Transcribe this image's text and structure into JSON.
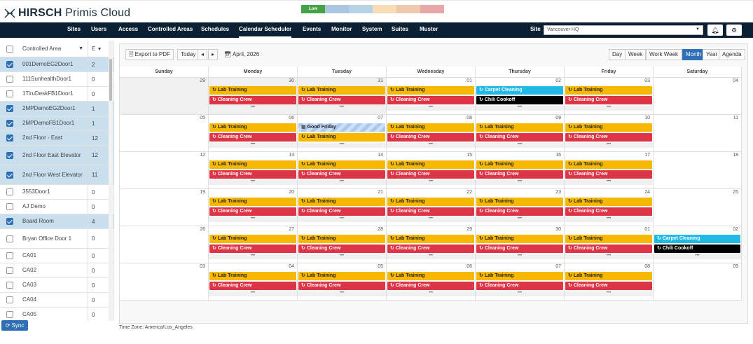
{
  "header": {
    "brand_bold": "HIRSCH",
    "brand_light": " Primis Cloud",
    "legend": [
      {
        "label": "Low",
        "color": "#43a443"
      },
      {
        "label": "",
        "color": "#a9c6e0"
      },
      {
        "label": "",
        "color": "#b8d2e6"
      },
      {
        "label": "",
        "color": "#f8dcb4"
      },
      {
        "label": "",
        "color": "#efc8b0"
      },
      {
        "label": "",
        "color": "#e8a7a7"
      }
    ]
  },
  "nav": {
    "items": [
      "Sites",
      "Users",
      "Access",
      "Controlled Areas",
      "Schedules",
      "Calendar Scheduler",
      "Events",
      "Monitor",
      "System",
      "Suites",
      "Muster"
    ],
    "active": "Calendar Scheduler",
    "site_label": "Site",
    "site_value": "Vancouver HQ"
  },
  "sidebar": {
    "col_area": "Controlled Area",
    "col_count": "E",
    "rows": [
      {
        "name": "001DemoEG2Door1",
        "count": "2",
        "checked": true
      },
      {
        "name": "111SunhealthDoor1",
        "count": "0",
        "checked": false
      },
      {
        "name": "1TiruDeskFB1Door1",
        "count": "0",
        "checked": false
      },
      {
        "name": "2MPDemoEG2Door1",
        "count": "1",
        "checked": true
      },
      {
        "name": "2MPDemoFB1Door1",
        "count": "1",
        "checked": true
      },
      {
        "name": "2nd Floor - East",
        "count": "12",
        "checked": true
      },
      {
        "name": "2nd Floor East Elevator",
        "count": "12",
        "checked": true
      },
      {
        "name": "2nd Floor West Elevator",
        "count": "11",
        "checked": true
      },
      {
        "name": "3553Door1",
        "count": "0",
        "checked": false
      },
      {
        "name": "AJ Demo",
        "count": "0",
        "checked": false
      },
      {
        "name": "Board Room",
        "count": "4",
        "checked": true
      },
      {
        "name": "Bryan Office Door 1",
        "count": "0",
        "checked": false
      },
      {
        "name": "CA01",
        "count": "0",
        "checked": false
      },
      {
        "name": "CA02",
        "count": "0",
        "checked": false
      },
      {
        "name": "CA03",
        "count": "0",
        "checked": false
      },
      {
        "name": "CA04",
        "count": "0",
        "checked": false
      },
      {
        "name": "CA05",
        "count": "0",
        "checked": false
      }
    ],
    "sync_label": "Sync"
  },
  "toolbar": {
    "export_label": "Export to PDF",
    "today_label": "Today",
    "prev": "◂",
    "next": "▸",
    "month_label": "April, 2026",
    "views": [
      "Day",
      "Week",
      "Work Week",
      "Month",
      "Year",
      "Agenda"
    ],
    "active_view": "Month"
  },
  "calendar": {
    "days": [
      "Sunday",
      "Monday",
      "Tuesday",
      "Wednesday",
      "Thursday",
      "Friday",
      "Saturday"
    ],
    "weeks": [
      [
        {
          "num": "29",
          "past": true,
          "events": [],
          "more": false
        },
        {
          "num": "30",
          "past": true,
          "events": [
            {
              "t": "lab",
              "label": "Lab Training"
            },
            {
              "t": "clean",
              "label": "Cleaning Crew"
            }
          ],
          "more": true
        },
        {
          "num": "31",
          "past": true,
          "events": [
            {
              "t": "lab",
              "label": "Lab Training"
            },
            {
              "t": "clean",
              "label": "Cleaning Crew"
            }
          ],
          "more": true
        },
        {
          "num": "01",
          "past": false,
          "events": [
            {
              "t": "lab",
              "label": "Lab Training"
            },
            {
              "t": "clean",
              "label": "Cleaning Crew"
            }
          ],
          "more": true
        },
        {
          "num": "02",
          "past": false,
          "events": [
            {
              "t": "carpet",
              "label": "Carpet Cleaning"
            },
            {
              "t": "chili",
              "label": "Chili Cookoff"
            }
          ],
          "more": true
        },
        {
          "num": "03",
          "past": false,
          "events": [
            {
              "t": "lab",
              "label": "Lab Training"
            },
            {
              "t": "clean",
              "label": "Cleaning Crew"
            }
          ],
          "more": true
        },
        {
          "num": "04",
          "past": false,
          "events": [],
          "more": false
        }
      ],
      [
        {
          "num": "05",
          "past": false,
          "events": [],
          "more": false
        },
        {
          "num": "06",
          "past": false,
          "events": [
            {
              "t": "lab",
              "label": "Lab Training"
            },
            {
              "t": "clean",
              "label": "Cleaning Crew"
            }
          ],
          "more": true
        },
        {
          "num": "07",
          "past": false,
          "events": [
            {
              "t": "holiday",
              "label": "Good Friday"
            },
            {
              "t": "lab",
              "label": "Lab Training"
            }
          ],
          "more": true
        },
        {
          "num": "08",
          "past": false,
          "events": [
            {
              "t": "lab",
              "label": "Lab Training"
            },
            {
              "t": "clean",
              "label": "Cleaning Crew"
            }
          ],
          "more": true
        },
        {
          "num": "09",
          "past": false,
          "events": [
            {
              "t": "lab",
              "label": "Lab Training"
            },
            {
              "t": "clean",
              "label": "Cleaning Crew"
            }
          ],
          "more": true
        },
        {
          "num": "10",
          "past": false,
          "events": [
            {
              "t": "lab",
              "label": "Lab Training"
            },
            {
              "t": "clean",
              "label": "Cleaning Crew"
            }
          ],
          "more": true
        },
        {
          "num": "11",
          "past": false,
          "events": [],
          "more": false
        }
      ],
      [
        {
          "num": "12",
          "past": false,
          "events": [],
          "more": false
        },
        {
          "num": "13",
          "past": false,
          "events": [
            {
              "t": "lab",
              "label": "Lab Training"
            },
            {
              "t": "clean",
              "label": "Cleaning Crew"
            }
          ],
          "more": true
        },
        {
          "num": "14",
          "past": false,
          "events": [
            {
              "t": "lab",
              "label": "Lab Training"
            },
            {
              "t": "clean",
              "label": "Cleaning Crew"
            }
          ],
          "more": true
        },
        {
          "num": "15",
          "past": false,
          "events": [
            {
              "t": "lab",
              "label": "Lab Training"
            },
            {
              "t": "clean",
              "label": "Cleaning Crew"
            }
          ],
          "more": true
        },
        {
          "num": "16",
          "past": false,
          "events": [
            {
              "t": "lab",
              "label": "Lab Training"
            },
            {
              "t": "clean",
              "label": "Cleaning Crew"
            }
          ],
          "more": true
        },
        {
          "num": "17",
          "past": false,
          "events": [
            {
              "t": "lab",
              "label": "Lab Training"
            },
            {
              "t": "clean",
              "label": "Cleaning Crew"
            }
          ],
          "more": true
        },
        {
          "num": "18",
          "past": false,
          "events": [],
          "more": false
        }
      ],
      [
        {
          "num": "19",
          "past": false,
          "events": [],
          "more": false
        },
        {
          "num": "20",
          "past": false,
          "events": [
            {
              "t": "lab",
              "label": "Lab Training"
            },
            {
              "t": "clean",
              "label": "Cleaning Crew"
            }
          ],
          "more": true
        },
        {
          "num": "21",
          "past": false,
          "events": [
            {
              "t": "lab",
              "label": "Lab Training"
            },
            {
              "t": "clean",
              "label": "Cleaning Crew"
            }
          ],
          "more": true
        },
        {
          "num": "22",
          "past": false,
          "events": [
            {
              "t": "lab",
              "label": "Lab Training"
            },
            {
              "t": "clean",
              "label": "Cleaning Crew"
            }
          ],
          "more": true
        },
        {
          "num": "23",
          "past": false,
          "events": [
            {
              "t": "lab",
              "label": "Lab Training"
            },
            {
              "t": "clean",
              "label": "Cleaning Crew"
            }
          ],
          "more": true
        },
        {
          "num": "24",
          "past": false,
          "events": [
            {
              "t": "lab",
              "label": "Lab Training"
            },
            {
              "t": "clean",
              "label": "Cleaning Crew"
            }
          ],
          "more": true
        },
        {
          "num": "25",
          "past": false,
          "events": [],
          "more": false
        }
      ],
      [
        {
          "num": "26",
          "past": false,
          "events": [],
          "more": false
        },
        {
          "num": "27",
          "past": false,
          "events": [
            {
              "t": "lab",
              "label": "Lab Training"
            },
            {
              "t": "clean",
              "label": "Cleaning Crew"
            }
          ],
          "more": true
        },
        {
          "num": "28",
          "past": false,
          "events": [
            {
              "t": "lab",
              "label": "Lab Training"
            },
            {
              "t": "clean",
              "label": "Cleaning Crew"
            }
          ],
          "more": true
        },
        {
          "num": "29",
          "past": false,
          "events": [
            {
              "t": "lab",
              "label": "Lab Training"
            },
            {
              "t": "clean",
              "label": "Cleaning Crew"
            }
          ],
          "more": true
        },
        {
          "num": "30",
          "past": false,
          "events": [
            {
              "t": "lab",
              "label": "Lab Training"
            },
            {
              "t": "clean",
              "label": "Cleaning Crew"
            }
          ],
          "more": true
        },
        {
          "num": "01",
          "past": false,
          "events": [
            {
              "t": "lab",
              "label": "Lab Training"
            },
            {
              "t": "clean",
              "label": "Cleaning Crew"
            }
          ],
          "more": true
        },
        {
          "num": "02",
          "past": false,
          "events": [
            {
              "t": "carpet",
              "label": "Carpet Cleaning"
            },
            {
              "t": "chili",
              "label": "Chili Cookoff"
            }
          ],
          "more": true
        }
      ],
      [
        {
          "num": "03",
          "past": false,
          "events": [],
          "more": false
        },
        {
          "num": "04",
          "past": false,
          "events": [
            {
              "t": "lab",
              "label": "Lab Training"
            },
            {
              "t": "clean",
              "label": "Cleaning Crew"
            }
          ],
          "more": true
        },
        {
          "num": "05",
          "past": false,
          "events": [
            {
              "t": "lab",
              "label": "Lab Training"
            },
            {
              "t": "clean",
              "label": "Cleaning Crew"
            }
          ],
          "more": true
        },
        {
          "num": "06",
          "past": false,
          "events": [
            {
              "t": "lab",
              "label": "Lab Training"
            },
            {
              "t": "clean",
              "label": "Cleaning Crew"
            }
          ],
          "more": true
        },
        {
          "num": "07",
          "past": false,
          "events": [
            {
              "t": "lab",
              "label": "Lab Training"
            },
            {
              "t": "clean",
              "label": "Cleaning Crew"
            }
          ],
          "more": true
        },
        {
          "num": "08",
          "past": false,
          "events": [
            {
              "t": "lab",
              "label": "Lab Training"
            },
            {
              "t": "clean",
              "label": "Cleaning Crew"
            }
          ],
          "more": true
        },
        {
          "num": "09",
          "past": false,
          "events": [],
          "more": false
        }
      ]
    ],
    "more_glyph": "•••",
    "timezone": "Time Zone: America/Los_Angeles"
  }
}
